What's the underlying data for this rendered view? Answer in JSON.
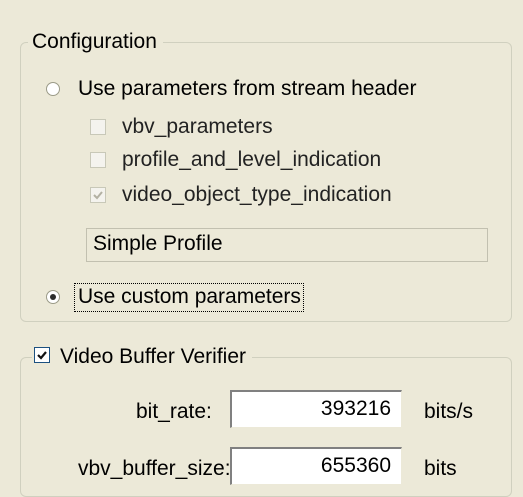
{
  "configuration": {
    "title": "Configuration",
    "radio_stream_header": {
      "label": "Use parameters from stream header",
      "selected": false
    },
    "checkboxes": [
      {
        "label": "vbv_parameters",
        "checked": false,
        "enabled": false
      },
      {
        "label": "profile_and_level_indication",
        "checked": false,
        "enabled": false
      },
      {
        "label": "video_object_type_indication",
        "checked": true,
        "enabled": false
      }
    ],
    "profile_value": "Simple Profile",
    "radio_custom": {
      "label": "Use custom parameters",
      "selected": true
    }
  },
  "vbv": {
    "title": "Video Buffer Verifier",
    "checked": true,
    "fields": [
      {
        "label": "bit_rate:",
        "value": "393216",
        "unit": "bits/s"
      },
      {
        "label": "vbv_buffer_size:",
        "value": "655360",
        "unit": "bits"
      }
    ]
  }
}
